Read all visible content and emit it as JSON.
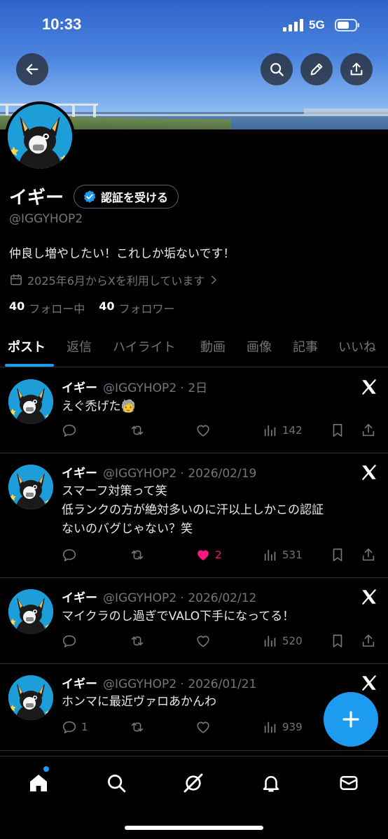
{
  "status_bar": {
    "time": "10:33",
    "network": "5G"
  },
  "header": {
    "back_icon": "arrow-left-icon",
    "search_icon": "search-icon",
    "edit_icon": "pencil-icon",
    "share_icon": "share-icon"
  },
  "profile": {
    "display_name": "イギー",
    "verify_label": "認証を受ける",
    "handle": "@IGGYHOP2",
    "bio": "仲良し増やしたい！これしか垢ないです！",
    "joined": "2025年6月からXを利用しています",
    "following_count": "40",
    "following_label": "フォロー中",
    "followers_count": "40",
    "followers_label": "フォロワー"
  },
  "tabs": [
    "ポスト",
    "返信",
    "ハイライト",
    "動画",
    "画像",
    "記事",
    "いいね"
  ],
  "posts": [
    {
      "name": "イギー",
      "meta": "@IGGYHOP2 · 2日",
      "text": "えぐ禿げた",
      "emoji": "🧓",
      "replies": "",
      "likes": "",
      "views": "142"
    },
    {
      "name": "イギー",
      "meta": "@IGGYHOP2 · 2026/02/19",
      "text_lines": [
        "スマーフ対策って笑",
        "低ランクの方が絶対多いのに汗以上しかこの認証",
        "ないのバグじゃない？笑"
      ],
      "replies": "",
      "likes": "2",
      "views": "531"
    },
    {
      "name": "イギー",
      "meta": "@IGGYHOP2 · 2026/02/12",
      "text": "マイクラのし過ぎでVALO下手になってる！",
      "replies": "",
      "likes": "",
      "views": "520"
    },
    {
      "name": "イギー",
      "meta": "@IGGYHOP2 · 2026/01/21",
      "text": "ホンマに最近ヴァロあかんわ",
      "replies": "1",
      "likes": "",
      "views": "939"
    }
  ],
  "colors": {
    "accent": "#1d9bf0",
    "like": "#f91880",
    "muted": "#71767b",
    "background": "#000000"
  },
  "bottom_nav": [
    "home-icon",
    "search-icon",
    "grok-icon",
    "bell-icon",
    "mail-icon"
  ]
}
